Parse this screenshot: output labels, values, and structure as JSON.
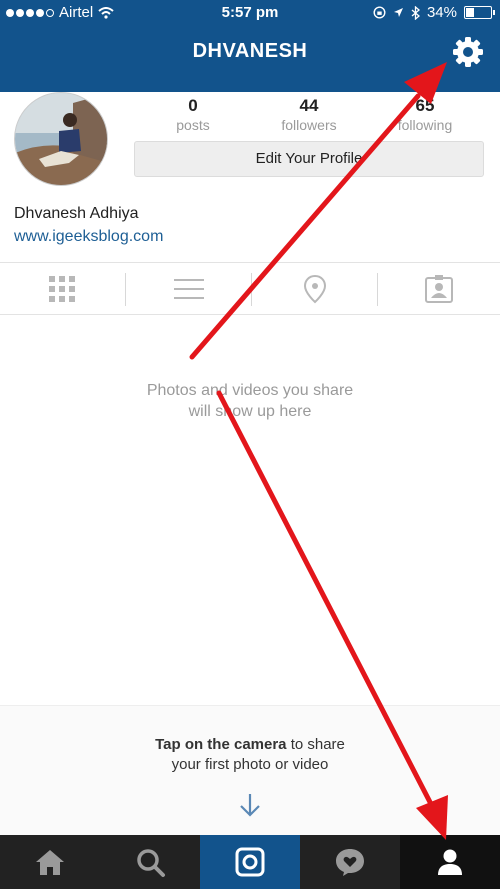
{
  "status_bar": {
    "carrier": "Airtel",
    "time": "5:57 pm",
    "battery": "34%",
    "battery_level": 0.34
  },
  "nav": {
    "title": "DHVANESH",
    "settings_icon": "gear-icon"
  },
  "profile": {
    "stats": [
      {
        "value": "0",
        "label": "posts"
      },
      {
        "value": "44",
        "label": "followers"
      },
      {
        "value": "65",
        "label": "following"
      }
    ],
    "edit_button": "Edit Your Profile",
    "full_name": "Dhvanesh Adhiya",
    "website": "www.igeeksblog.com"
  },
  "tabs": [
    {
      "name": "grid",
      "icon": "grid-icon"
    },
    {
      "name": "list",
      "icon": "list-icon"
    },
    {
      "name": "map",
      "icon": "location-pin-icon"
    },
    {
      "name": "tagged",
      "icon": "tagged-photo-icon"
    }
  ],
  "empty_state": {
    "line1": "Photos and videos you share",
    "line2": "will show up here"
  },
  "camera_prompt": {
    "bold": "Tap on the camera",
    "rest": " to share",
    "line2": "your first photo or video"
  },
  "tabbar": [
    "home-icon",
    "search-icon",
    "camera-icon",
    "activity-heart-icon",
    "profile-icon"
  ],
  "colors": {
    "brand_blue": "#12538c",
    "link_blue": "#1e5f95",
    "annotation_red": "#e3161b"
  }
}
